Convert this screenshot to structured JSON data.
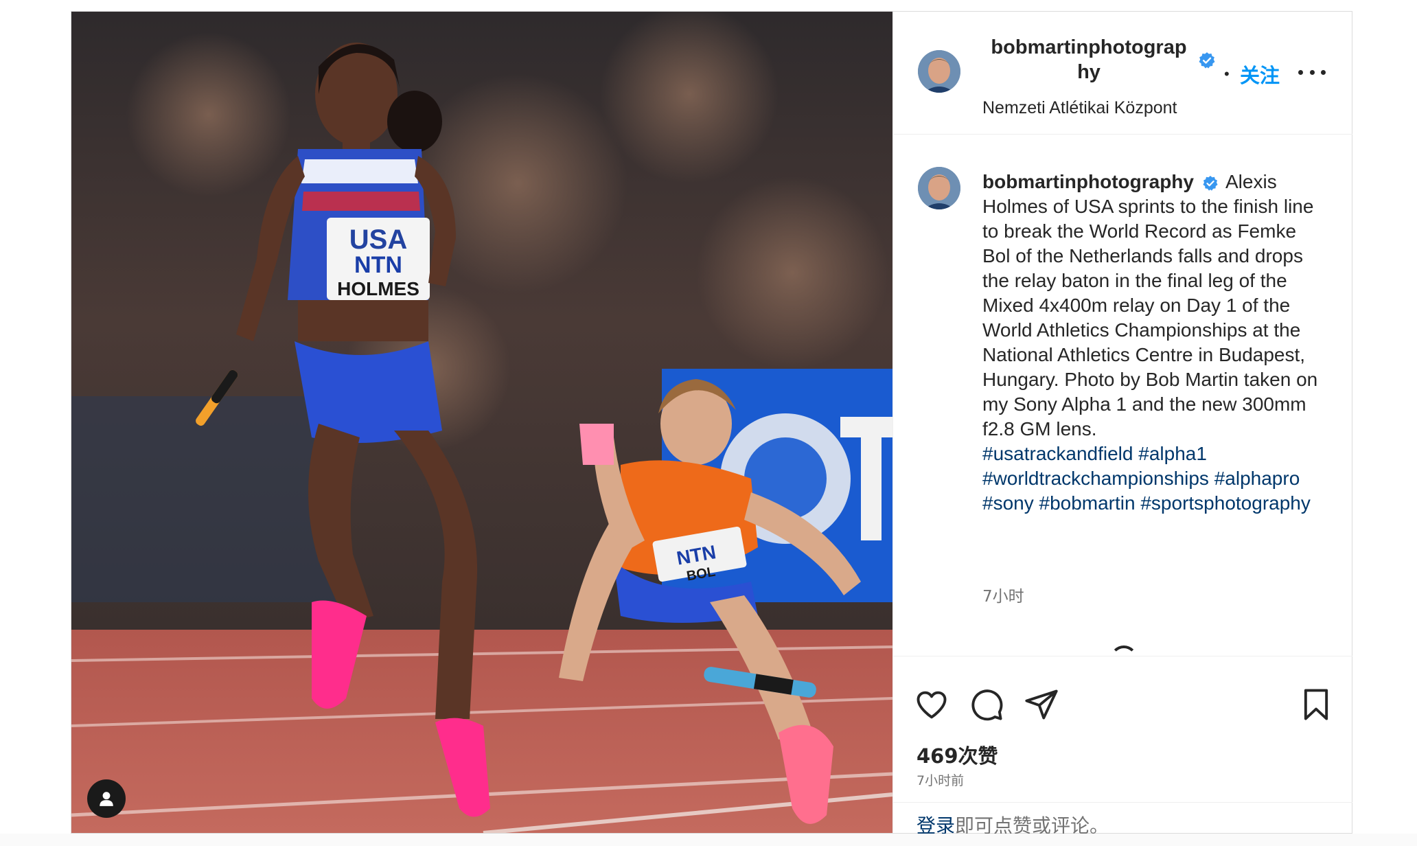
{
  "post": {
    "username": "bobmartinphotography",
    "username_line1": "bobmartinphotograp",
    "username_line2": "hy",
    "location": "Nemzeti Atlétikai Központ",
    "follow_label": "关注",
    "separator": "•"
  },
  "photo": {
    "bib_country": "USA",
    "bib_sponsor": "NTN",
    "bib_name": "HOLMES",
    "bib2_sponsor": "NTN",
    "bib2_name": "BOL"
  },
  "caption": {
    "username": "bobmartinphotography",
    "text": "Alexis Holmes of USA sprints to the finish line to break the World Record as Femke Bol of the Netherlands falls and drops the relay baton in the final leg of the Mixed 4x400m relay on Day 1 of the World Athletics Championships at the National Athletics Centre in Budapest, Hungary. Photo by Bob Martin taken on my Sony Alpha 1 and the new 300mm f2.8 GM lens.",
    "hashtags": "#usatrackandfield #alpha1 #worldtrackchampionships #alphapro #sony #bobmartin #sportsphotography",
    "time": "7小时"
  },
  "stats": {
    "likes": "469次赞",
    "time": "7小时前"
  },
  "login": {
    "link": "登录",
    "text": "即可点赞或评论。"
  },
  "icons": {
    "like": "heart-icon",
    "comment": "comment-icon",
    "share": "paper-plane-icon",
    "save": "bookmark-icon",
    "verified": "verified-badge-icon",
    "more": "more-horizontal-icon",
    "tag": "user-tag-icon"
  },
  "colors": {
    "accent": "#0095f6",
    "hashtag": "#00376b",
    "verified": "#3897f0",
    "muted": "#737373"
  }
}
